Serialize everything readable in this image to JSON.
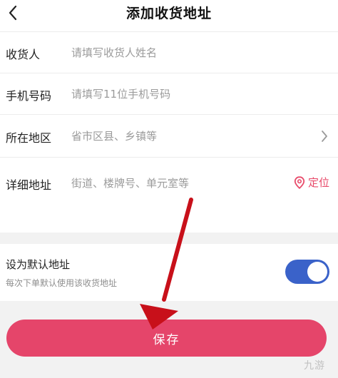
{
  "header": {
    "title": "添加收货地址",
    "back_icon": "chevron-left-icon"
  },
  "form": {
    "recipient": {
      "label": "收货人",
      "placeholder": "请填写收货人姓名"
    },
    "phone": {
      "label": "手机号码",
      "placeholder": "请填写11位手机号码"
    },
    "region": {
      "label": "所在地区",
      "placeholder": "省市区县、乡镇等",
      "icon": "chevron-right-icon"
    },
    "detail": {
      "label": "详细地址",
      "placeholder": "街道、楼牌号、单元室等",
      "locate_label": "定位",
      "locate_icon": "location-pin-icon"
    }
  },
  "default_address": {
    "title": "设为默认地址",
    "subtitle": "每次下单默认使用该收货地址",
    "enabled": true
  },
  "save": {
    "label": "保存"
  },
  "watermark": {
    "text": "九游"
  },
  "colors": {
    "accent": "#e5456a",
    "toggle_on": "#3a62c9",
    "arrow": "#c8101a",
    "locate": "#e84a6a"
  }
}
